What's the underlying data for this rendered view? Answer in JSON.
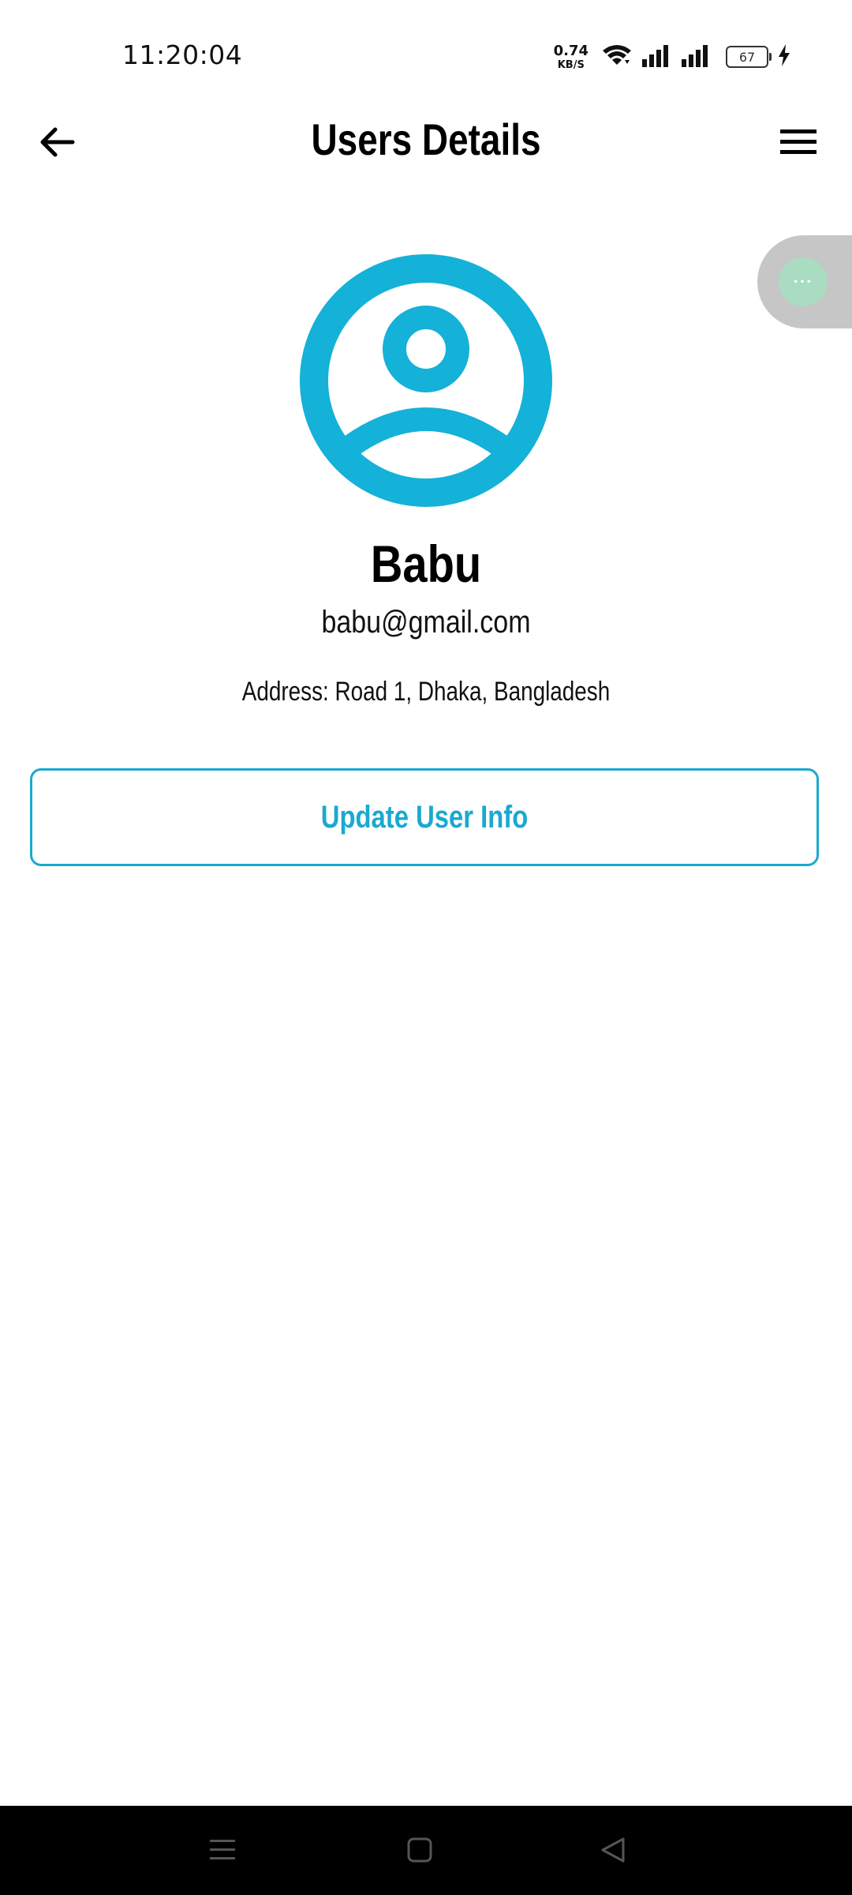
{
  "status_bar": {
    "time": "11:20:04",
    "net_speed_value": "0.74",
    "net_speed_unit": "KB/S",
    "battery_level": "67"
  },
  "app_bar": {
    "title": "Users Details",
    "back_icon": "arrow-left-icon",
    "menu_icon": "hamburger-menu-icon"
  },
  "floating_bubble": {
    "label": "···"
  },
  "user": {
    "name": "Babu",
    "email": "babu@gmail.com",
    "address": "Address: Road 1, Dhaka, Bangladesh"
  },
  "actions": {
    "update_label": "Update User Info"
  },
  "colors": {
    "accent": "#1AA9CF",
    "avatar": "#14B1D8",
    "nav_bar": "#000000"
  },
  "nav_bar": {
    "icons": [
      "recents-icon",
      "home-icon",
      "back-triangle-icon"
    ]
  }
}
